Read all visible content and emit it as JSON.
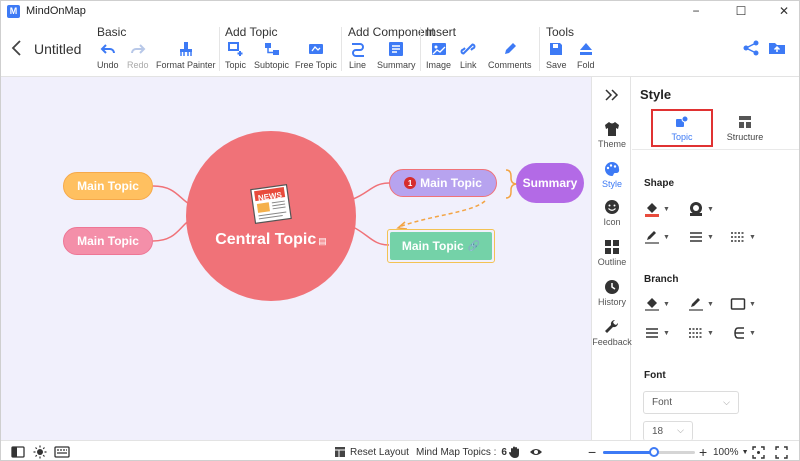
{
  "app": {
    "title": "MindOnMap",
    "logo_letter": "M"
  },
  "window": {
    "minimize": "−",
    "maximize": "☐",
    "close": "✕"
  },
  "toolbar": {
    "doc_title": "Untitled",
    "groups": {
      "basic": "Basic",
      "add_topic": "Add Topic",
      "add_component": "Add Component",
      "insert": "Insert",
      "tools": "Tools"
    },
    "buttons": {
      "undo": "Undo",
      "redo": "Redo",
      "format_painter": "Format Painter",
      "topic": "Topic",
      "subtopic": "Subtopic",
      "free_topic": "Free Topic",
      "line": "Line",
      "summary": "Summary",
      "image": "Image",
      "link": "Link",
      "comments": "Comments",
      "save": "Save",
      "fold": "Fold"
    }
  },
  "canvas": {
    "central_topic": "Central Topic",
    "news_label": "NEWS",
    "left_topic_1": "Main Topic",
    "left_topic_2": "Main Topic",
    "right_topic_1": "Main Topic",
    "right_topic_1_badge": "1",
    "right_topic_2": "Main Topic",
    "summary": "Summary"
  },
  "sidebar": {
    "items": [
      {
        "label": "Theme",
        "icon": "shirt-icon"
      },
      {
        "label": "Style",
        "icon": "palette-icon"
      },
      {
        "label": "Icon",
        "icon": "smiley-icon"
      },
      {
        "label": "Outline",
        "icon": "outline-icon"
      },
      {
        "label": "History",
        "icon": "clock-icon"
      },
      {
        "label": "Feedback",
        "icon": "wrench-icon"
      }
    ],
    "active": "Style"
  },
  "panel": {
    "title": "Style",
    "tabs": {
      "topic": "Topic",
      "structure": "Structure"
    },
    "active_tab": "Topic",
    "sections": {
      "shape": "Shape",
      "branch": "Branch",
      "font": "Font"
    },
    "font_family": "Font",
    "font_size": "18"
  },
  "statusbar": {
    "reset_layout": "Reset Layout",
    "topics_label": "Mind Map Topics :",
    "topics_count": "6",
    "zoom": "100%",
    "zoom_level": 0.55
  },
  "colors": {
    "accent": "#3d7af5",
    "central": "#f07278",
    "left_topic_1": "#ffc060",
    "left_topic_2": "#f48fa9",
    "right_topic_1": "#b7a3ef",
    "right_topic_2": "#74d2a8",
    "summary": "#b36ae6",
    "canvas": "#f1f0fc",
    "highlight": "#e03232"
  }
}
